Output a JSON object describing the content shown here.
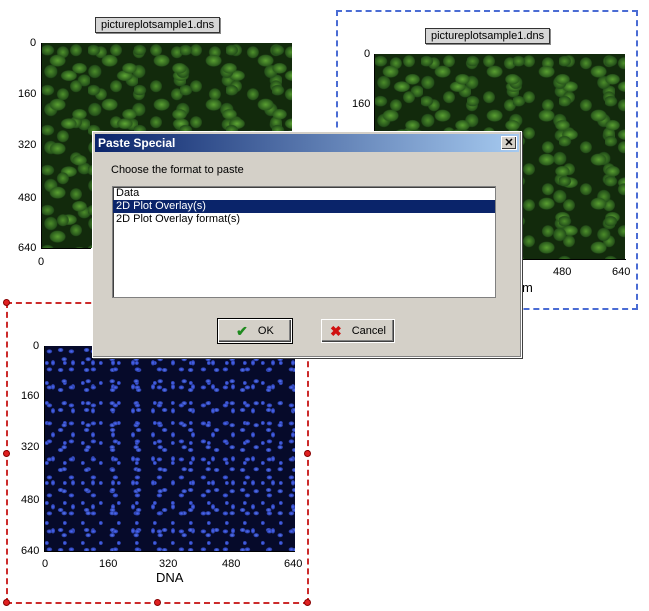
{
  "plots": [
    {
      "title": "pictureplotsample1.dns",
      "y_ticks": [
        "0",
        "160",
        "320",
        "480",
        "640"
      ],
      "x_ticks": [
        "0"
      ],
      "xlabel": ""
    },
    {
      "title": "pictureplotsample1.dns",
      "y_ticks": [
        "0",
        "160"
      ],
      "x_ticks": [
        "480",
        "640"
      ],
      "xlabel": "m"
    },
    {
      "title": "",
      "y_ticks": [
        "0",
        "160",
        "320",
        "480",
        "640"
      ],
      "x_ticks": [
        "0",
        "160",
        "320",
        "480",
        "640"
      ],
      "xlabel": "DNA"
    }
  ],
  "dialog": {
    "title": "Paste Special",
    "close_glyph": "✕",
    "prompt": "Choose the format to paste",
    "options": [
      "Data",
      "2D Plot Overlay(s)",
      "2D Plot Overlay format(s)"
    ],
    "selected_option": "2D Plot Overlay(s)",
    "ok_label": "OK",
    "cancel_label": "Cancel",
    "ok_icon": "checkmark-icon",
    "cancel_icon": "red-x-icon",
    "ok_color": "#1e8a1e",
    "cancel_color": "#d01010"
  },
  "colors": {
    "selection_red": "#cc2b2b",
    "selection_blue": "#4a6cd4",
    "titlebar_start": "#0a246a",
    "titlebar_end": "#a6caf0"
  }
}
